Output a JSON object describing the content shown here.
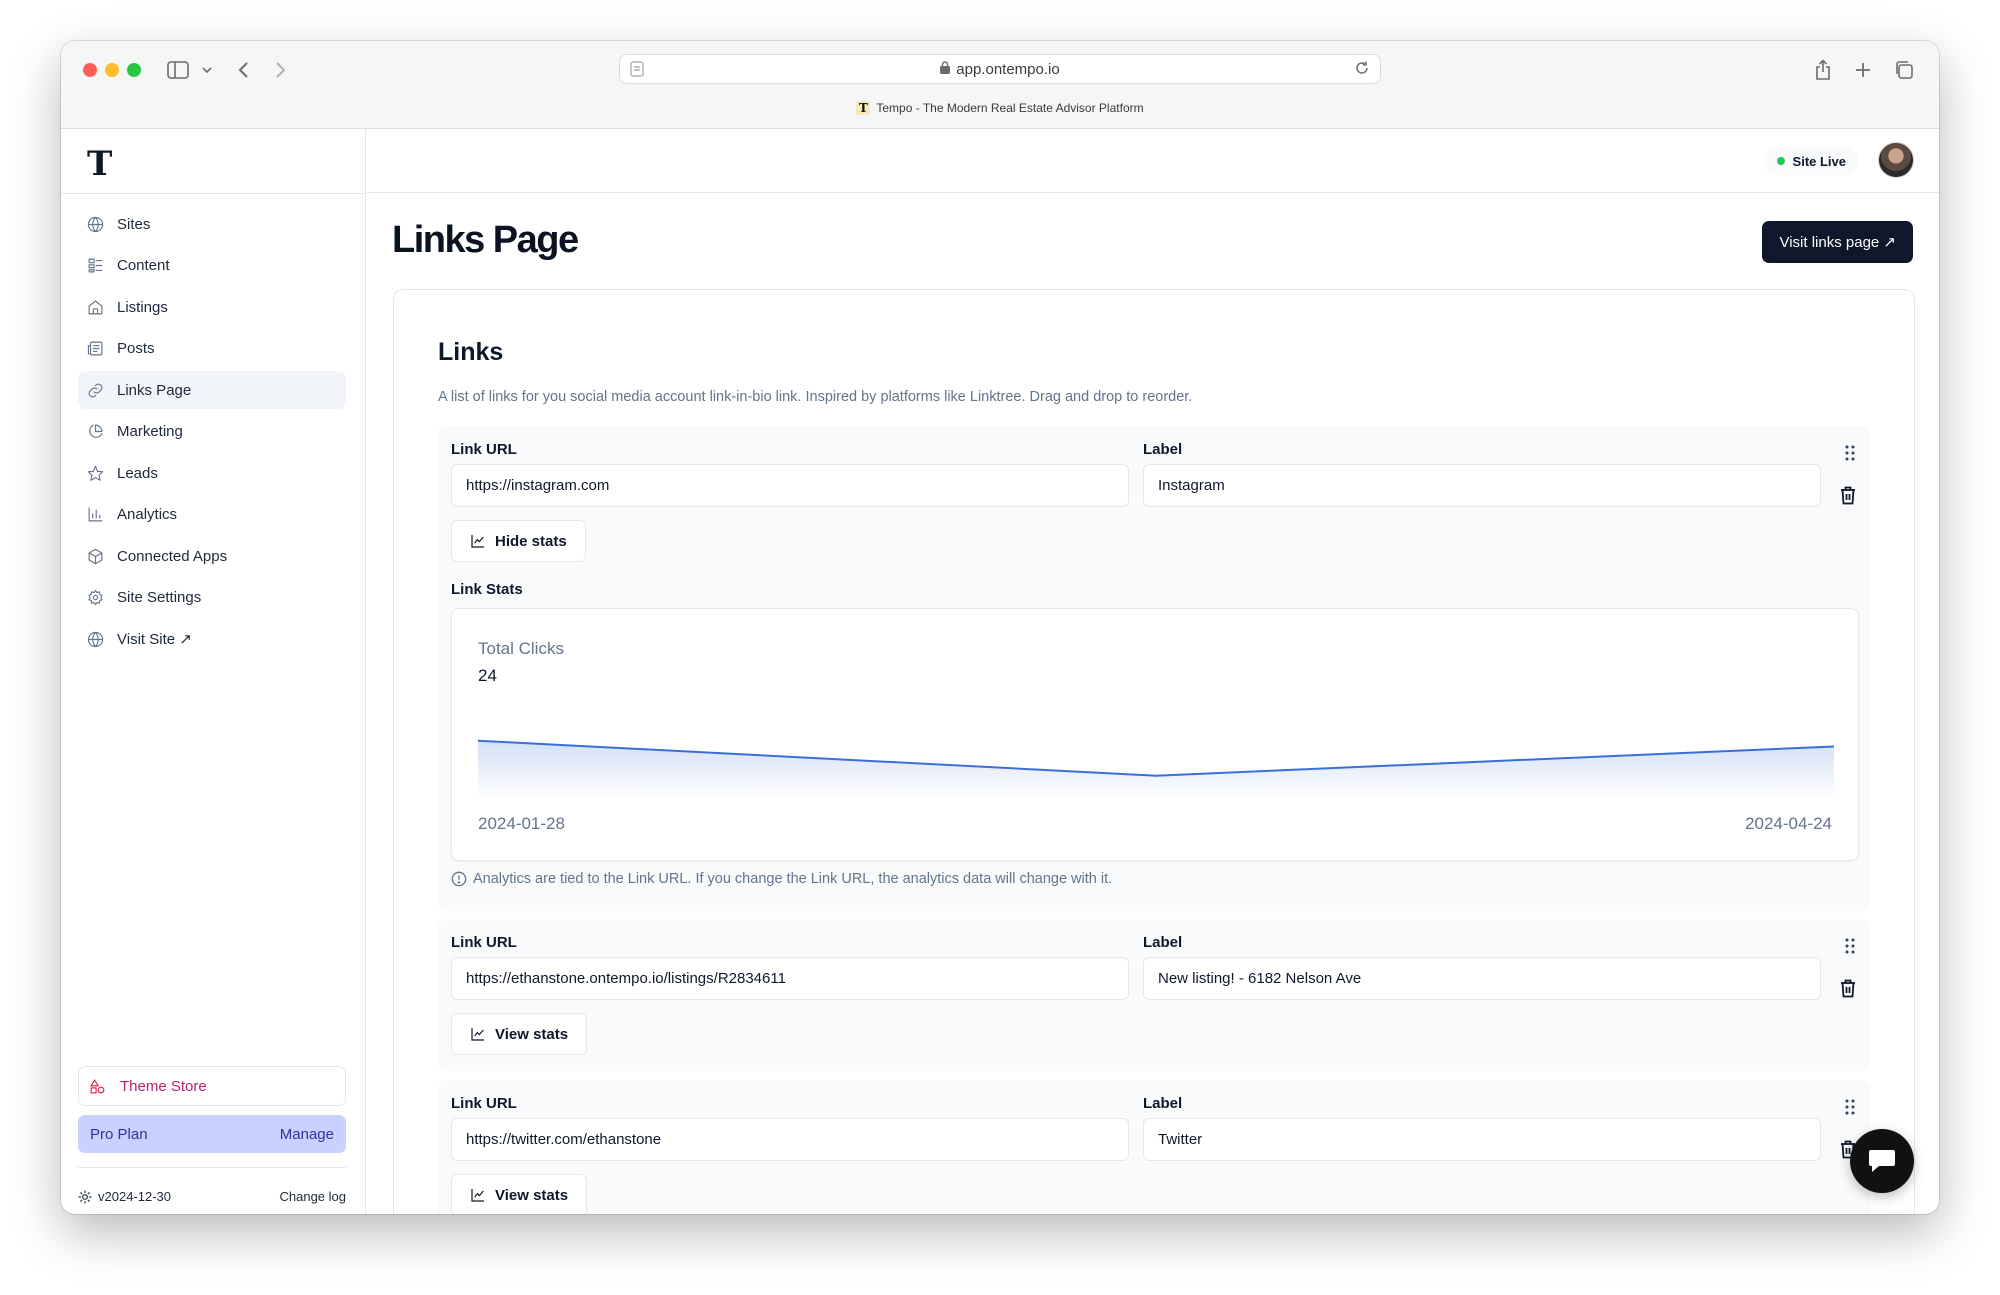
{
  "browser": {
    "url": "app.ontempo.io",
    "tab_title": "Tempo - The Modern Real Estate Advisor Platform",
    "favicon_letter": "T"
  },
  "sidebar": {
    "logo": "T",
    "items": [
      {
        "label": "Sites",
        "icon": "globe-icon"
      },
      {
        "label": "Content",
        "icon": "content-icon"
      },
      {
        "label": "Listings",
        "icon": "home-icon"
      },
      {
        "label": "Posts",
        "icon": "newspaper-icon"
      },
      {
        "label": "Links Page",
        "icon": "link-icon"
      },
      {
        "label": "Marketing",
        "icon": "pie-chart-icon"
      },
      {
        "label": "Leads",
        "icon": "star-icon"
      },
      {
        "label": "Analytics",
        "icon": "bar-chart-icon"
      },
      {
        "label": "Connected Apps",
        "icon": "box-icon"
      },
      {
        "label": "Site Settings",
        "icon": "gear-icon"
      },
      {
        "label": "Visit Site ↗",
        "icon": "globe-icon"
      }
    ],
    "active_item": "Links Page",
    "theme_store": "Theme Store",
    "plan": {
      "name": "Pro Plan",
      "action": "Manage"
    },
    "version": "v2024-12-30",
    "changelog": "Change log"
  },
  "header": {
    "status": "Site Live",
    "status_color": "#22c55e"
  },
  "page": {
    "title": "Links Page",
    "visit_button": "Visit links page ↗"
  },
  "links_card": {
    "title": "Links",
    "description": "A list of links for you social media account link-in-bio link. Inspired by platforms like Linktree. Drag and drop to reorder.",
    "url_label": "Link URL",
    "label_label": "Label",
    "links": [
      {
        "url": "https://instagram.com",
        "label": "Instagram",
        "stats_button": "Hide stats",
        "stats_title": "Link Stats",
        "total_clicks_label": "Total Clicks",
        "total_clicks": "24",
        "date_start": "2024-01-28",
        "date_end": "2024-04-24",
        "note": "Analytics are tied to the Link URL. If you change the Link URL, the analytics data will change with it."
      },
      {
        "url": "https://ethanstone.ontempo.io/listings/R2834611",
        "label": "New listing! - 6182 Nelson Ave",
        "stats_button": "View stats"
      },
      {
        "url": "https://twitter.com/ethanstone",
        "label": "Twitter",
        "stats_button": "View stats"
      }
    ]
  },
  "chart_data": {
    "type": "area",
    "x": [
      "2024-01-28",
      "2024-03-12",
      "2024-04-24"
    ],
    "values": [
      10,
      4,
      9
    ],
    "ylim": [
      0,
      12
    ],
    "grid": false,
    "color": "#3b6fd8"
  }
}
